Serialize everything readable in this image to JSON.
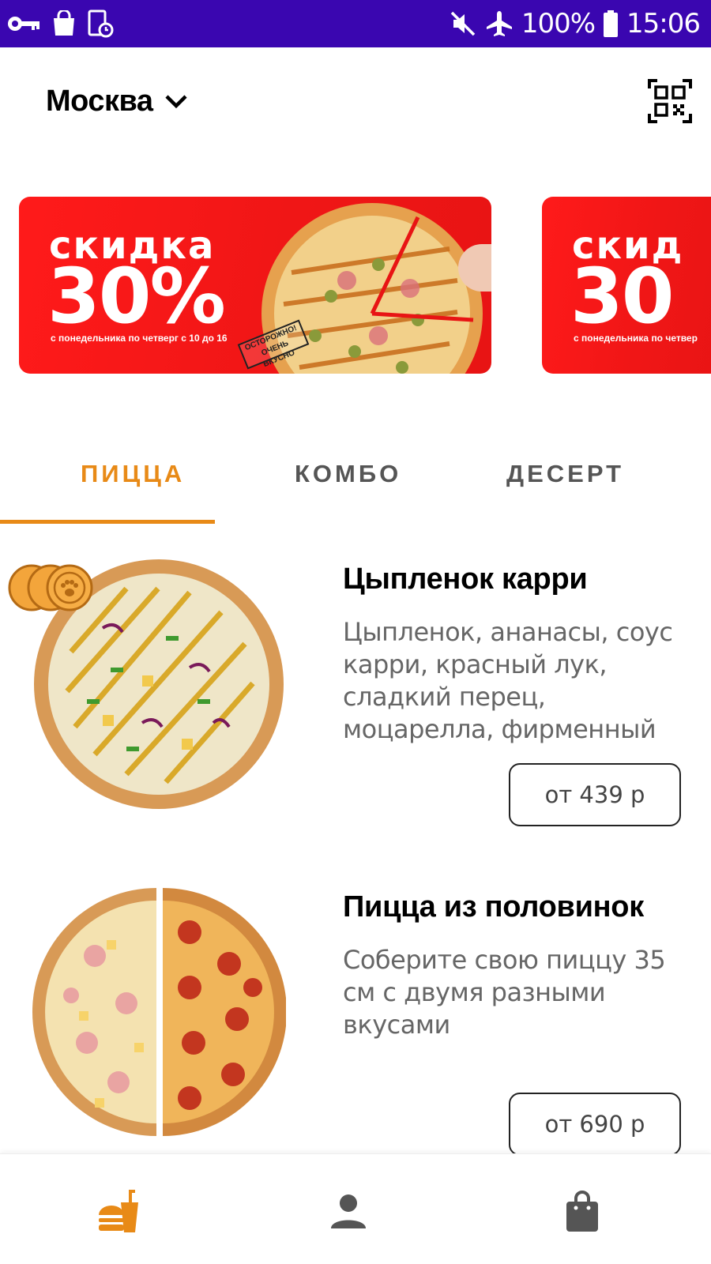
{
  "status_bar": {
    "battery": "100%",
    "time": "15:06",
    "icons_left": [
      "key-icon",
      "shopping-bag-icon",
      "screen-record-icon"
    ],
    "icons_right": [
      "mute-icon",
      "airplane-icon",
      "battery-icon"
    ]
  },
  "header": {
    "city": "Москва",
    "city_icon": "chevron-down-icon",
    "qr_icon": "qr-code-icon"
  },
  "banners": [
    {
      "headline": "скидка",
      "discount": "30%",
      "caption": "с понедельника по четверг с 10 до 16",
      "stamp": "ОСТОРОЖНО! ОЧЕНЬ ВКУСНО"
    },
    {
      "headline": "скид",
      "discount": "30",
      "caption": "с понедельника по четвер"
    }
  ],
  "tabs": [
    {
      "label": "ПИЦЦА",
      "active": true
    },
    {
      "label": "КОМБО",
      "active": false
    },
    {
      "label": "ДЕСЕРТ",
      "active": false
    }
  ],
  "products": [
    {
      "name": "Цыпленок карри",
      "description": "Цыпленок, ананасы, соус карри, красный лук, сладкий перец, моцарелла, фирменный",
      "price": "от 439 р"
    },
    {
      "name": "Пицца из половинок",
      "description": "Соберите свою пиццу 35 см с двумя разными вкусами",
      "price": "от 690 р"
    }
  ],
  "bottom_nav": [
    {
      "icon": "menu-food-icon",
      "active": true
    },
    {
      "icon": "profile-icon",
      "active": false
    },
    {
      "icon": "cart-bag-icon",
      "active": false
    }
  ],
  "colors": {
    "status_bar": "#3a06b0",
    "accent": "#e88a17",
    "banner_red": "#f01616"
  }
}
